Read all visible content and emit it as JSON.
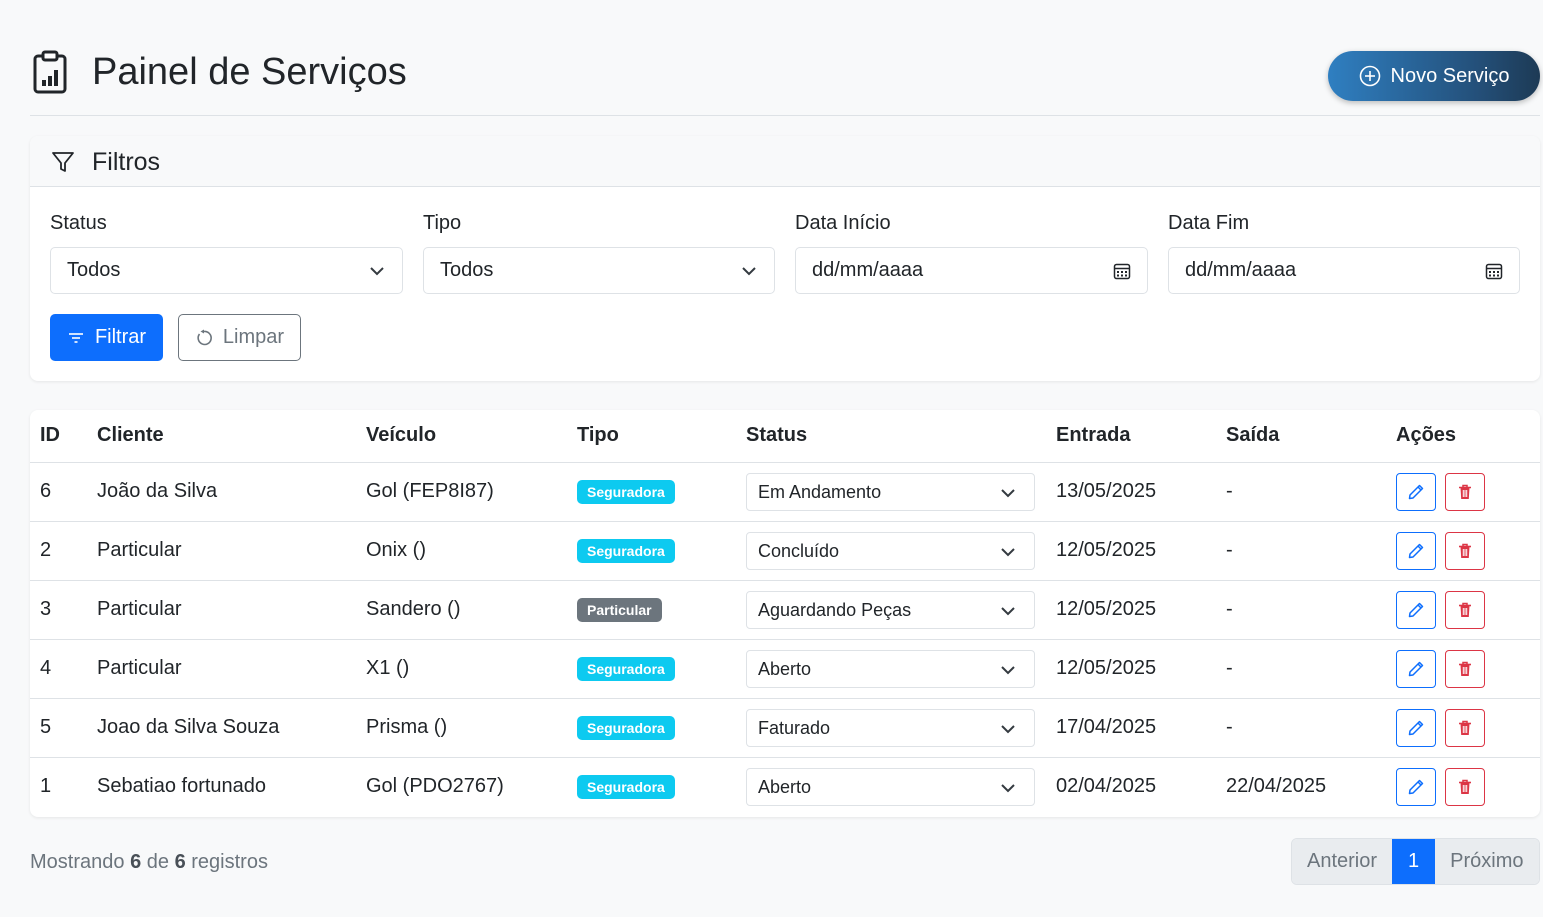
{
  "header": {
    "title": "Painel de Serviços",
    "new_button": "Novo Serviço"
  },
  "filters": {
    "title": "Filtros",
    "status": {
      "label": "Status",
      "value": "Todos"
    },
    "tipo": {
      "label": "Tipo",
      "value": "Todos"
    },
    "data_inicio": {
      "label": "Data Início",
      "placeholder": "dd/mm/aaaa"
    },
    "data_fim": {
      "label": "Data Fim",
      "placeholder": "dd/mm/aaaa"
    },
    "filter_button": "Filtrar",
    "clear_button": "Limpar"
  },
  "table": {
    "columns": [
      "ID",
      "Cliente",
      "Veículo",
      "Tipo",
      "Status",
      "Entrada",
      "Saída",
      "Ações"
    ],
    "rows": [
      {
        "id": "6",
        "cliente": "João da Silva",
        "veiculo": "Gol (FEP8I87)",
        "tipo": "Seguradora",
        "status": "Em Andamento",
        "entrada": "13/05/2025",
        "saida": "-"
      },
      {
        "id": "2",
        "cliente": "Particular",
        "veiculo": "Onix ()",
        "tipo": "Seguradora",
        "status": "Concluído",
        "entrada": "12/05/2025",
        "saida": "-"
      },
      {
        "id": "3",
        "cliente": "Particular",
        "veiculo": "Sandero ()",
        "tipo": "Particular",
        "status": "Aguardando Peças",
        "entrada": "12/05/2025",
        "saida": "-"
      },
      {
        "id": "4",
        "cliente": "Particular",
        "veiculo": "X1 ()",
        "tipo": "Seguradora",
        "status": "Aberto",
        "entrada": "12/05/2025",
        "saida": "-"
      },
      {
        "id": "5",
        "cliente": "Joao da Silva Souza",
        "veiculo": "Prisma ()",
        "tipo": "Seguradora",
        "status": "Faturado",
        "entrada": "17/04/2025",
        "saida": "-"
      },
      {
        "id": "1",
        "cliente": "Sebatiao fortunado",
        "veiculo": "Gol (PDO2767)",
        "tipo": "Seguradora",
        "status": "Aberto",
        "entrada": "02/04/2025",
        "saida": "22/04/2025"
      }
    ]
  },
  "footer": {
    "showing_prefix": "Mostrando",
    "shown": "6",
    "of": "de",
    "total": "6",
    "suffix": "registros",
    "prev": "Anterior",
    "page": "1",
    "next": "Próximo"
  },
  "colors": {
    "primary": "#0d6efd",
    "info": "#0dcaf0",
    "secondary": "#6c757d",
    "danger": "#dc3545"
  }
}
